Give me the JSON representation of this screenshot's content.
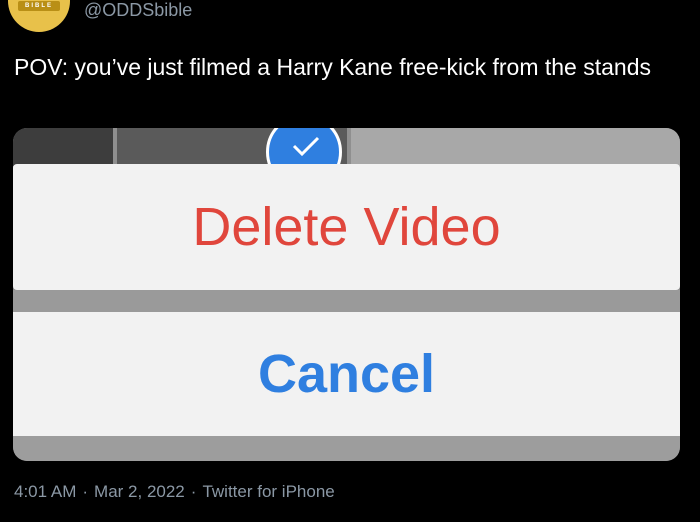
{
  "header": {
    "avatar_badge": "BIBLE",
    "handle": "@ODDSbible"
  },
  "tweet": {
    "text": "POV: you’ve just filmed a Harry Kane free-kick from the stands"
  },
  "media": {
    "delete_label": "Delete Video",
    "cancel_label": "Cancel"
  },
  "footer": {
    "time": "4:01 AM",
    "date": "Mar 2, 2022",
    "source": "Twitter for iPhone",
    "separator": "·"
  },
  "colors": {
    "background": "#000000",
    "delete": "#e0463c",
    "cancel": "#2f7fe0",
    "meta_text": "#8b98a5"
  }
}
